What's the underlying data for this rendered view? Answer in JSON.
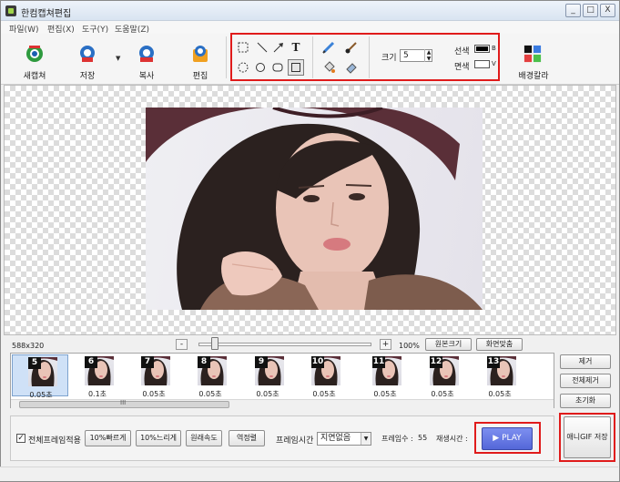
{
  "window": {
    "title": "한컴캡쳐편집",
    "buttons": [
      "_",
      "□",
      "X"
    ]
  },
  "menu": {
    "items": [
      "파일(W)",
      "편집(X)",
      "도구(Y)",
      "도움말(Z)"
    ]
  },
  "toolbar": {
    "new_capture": "새캡쳐",
    "save": "저장",
    "copy": "복사",
    "edit": "편집",
    "bg_color": "배경칼라",
    "size_label": "크기",
    "size_value": "5",
    "line_label": "선색",
    "line_key": "B",
    "fill_label": "면색",
    "fill_key": "V",
    "text_tool": "T",
    "colors": {
      "highlight_border": "#e01b1b",
      "line_color": "#000000",
      "fill_color": "#ffffff"
    }
  },
  "canvas": {
    "image_size": "588x320",
    "zoom": "100%",
    "original_size_button": "원본크기",
    "fit_screen_button": "화면맞춤",
    "zoom_minus": "-",
    "zoom_plus": "+"
  },
  "frames": [
    {
      "num": "5",
      "time": "0.05초",
      "selected": true
    },
    {
      "num": "6",
      "time": "0.1초",
      "selected": false
    },
    {
      "num": "7",
      "time": "0.05초",
      "selected": false
    },
    {
      "num": "8",
      "time": "0.05초",
      "selected": false
    },
    {
      "num": "9",
      "time": "0.05초",
      "selected": false
    },
    {
      "num": "10",
      "time": "0.05초",
      "selected": false
    },
    {
      "num": "11",
      "time": "0.05초",
      "selected": false
    },
    {
      "num": "12",
      "time": "0.05초",
      "selected": false
    },
    {
      "num": "13",
      "time": "0.05초",
      "selected": false
    }
  ],
  "scrollbar_grip": "III",
  "side_buttons": {
    "remove": "제거",
    "remove_all": "전체제거",
    "reset": "초기화",
    "save_gif": "애니GIF 저장"
  },
  "options": {
    "apply_all_frames": "전체프레임적용",
    "apply_all_checked": "✓",
    "faster": "10%빠르게",
    "slower": "10%느리게",
    "original_speed": "원래속도",
    "reverse": "역정렬",
    "frame_time_label": "프레임시간",
    "frame_time_value": "지연없음",
    "frame_count_label": "프레임수 :",
    "frame_count_value": "55",
    "play_time_label": "재생시간 :",
    "play_button": "▶ PLAY"
  }
}
